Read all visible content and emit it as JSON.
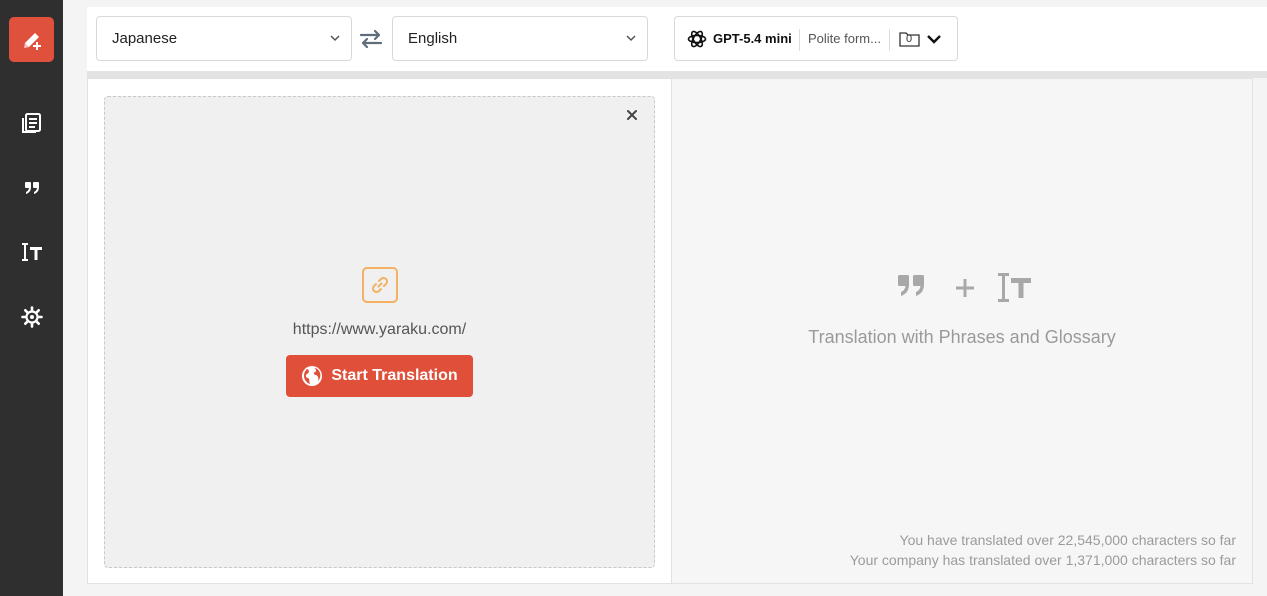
{
  "sidebar": {
    "items": [
      {
        "icon": "new-translation-icon"
      },
      {
        "icon": "documents-icon"
      },
      {
        "icon": "quote-icon"
      },
      {
        "icon": "glossary-icon"
      },
      {
        "icon": "settings-gear-icon"
      }
    ]
  },
  "language": {
    "source": "Japanese",
    "target": "English",
    "swap_icon": "swap-arrows-icon"
  },
  "model": {
    "name": "GPT-5.4 mini",
    "style": "Polite form...",
    "folder_count": "0"
  },
  "source_panel": {
    "url": "https://www.yaraku.com/",
    "start_button": "Start Translation"
  },
  "result_panel": {
    "feature_text": "Translation with Phrases and Glossary",
    "stats": {
      "user_line": "You have translated over 22,545,000 characters so far",
      "company_line": "Your company has translated over 1,371,000 characters so far"
    }
  },
  "colors": {
    "accent": "#df4f39",
    "sidebar_bg": "#2f2f2f",
    "link_icon": "#f4b163"
  }
}
